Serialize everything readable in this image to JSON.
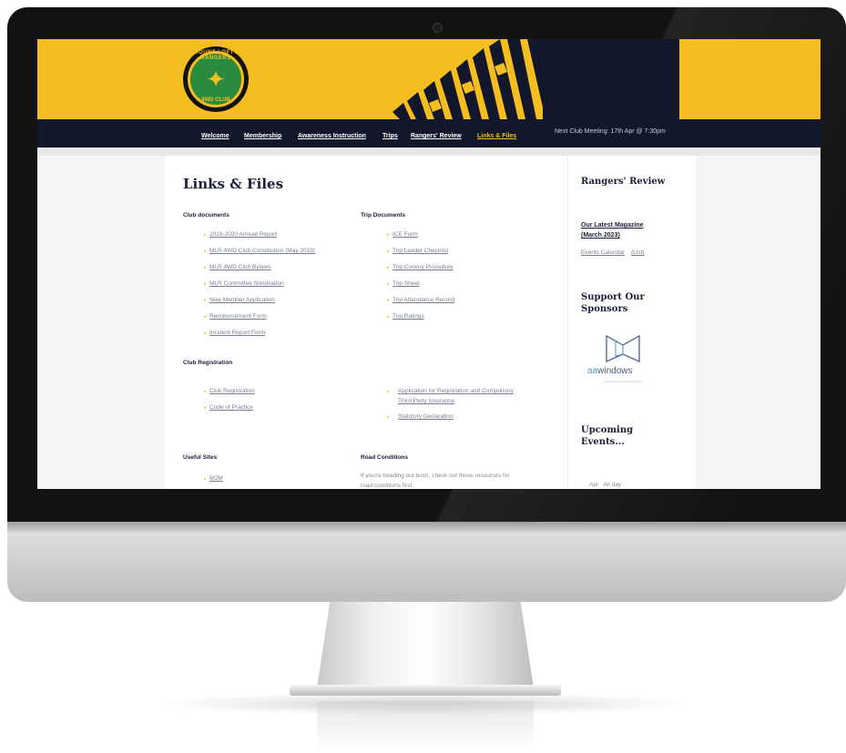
{
  "nav": {
    "items": [
      {
        "label": "Welcome"
      },
      {
        "label": "Membership"
      },
      {
        "label": "Awareness Instruction"
      },
      {
        "label": "Trips"
      },
      {
        "label": "Rangers' Review"
      },
      {
        "label": "Links & Files"
      }
    ],
    "next_meeting": "Next Club Meeting: 17th Apr @ 7:30pm"
  },
  "logo": {
    "ring_text": "MOUNT LOFTY RANGERS",
    "club_text": "4WD CLUB"
  },
  "page": {
    "title": "Links & Files",
    "club_documents": {
      "heading": "Club documents",
      "links": [
        "2019-2020 Annual Report",
        "MLR 4WD Club Constitution",
        "MLR 4WD Club Bylaws",
        "MLR Committee Nomination",
        "New Member Application",
        "Reimbursement Form",
        "Incident Report Form"
      ],
      "constitution_suffix": " (May 2019)"
    },
    "trip_documents": {
      "heading": "Trip Documents",
      "links": [
        "ICE Form",
        "Trip Leader Checklist",
        "Trip Convoy Procedure",
        "Trip Sheet",
        "Trip Attendance Record",
        "Trip Ratings"
      ]
    },
    "club_registration": {
      "heading": "Club Registration",
      "links": [
        "Club Registration",
        "Code of Practice"
      ],
      "right_links": [
        "Application for Registration and Compulsory",
        "Third Party Insurance",
        "Statutory Declaration"
      ]
    },
    "useful_sites": {
      "heading": "Useful Sites",
      "links": [
        "BOM"
      ]
    },
    "road_conditions": {
      "heading": "Road Conditions",
      "text_line1": "If you're heading out bush, check out these resources for",
      "text_line2": "road conditions first"
    }
  },
  "sidebar": {
    "rangers_review": {
      "heading": "Rangers' Review",
      "magazine_line1": "Our Latest Magazine",
      "magazine_line2": "(March 2023)",
      "events_calendar": "Events Calendar",
      "list_link": "(List)"
    },
    "sponsors": {
      "heading_line1": "Support Our",
      "heading_line2": "Sponsors",
      "sponsor_prefix": "aa",
      "sponsor_name": "windows"
    },
    "upcoming": {
      "heading_line1": "Upcoming",
      "heading_line2": "Events...",
      "row_month": "Apr",
      "row_day": "All day"
    }
  },
  "colors": {
    "brand_yellow": "#f4bd20",
    "navy": "#13172b",
    "link_grey": "#7a7f90"
  }
}
